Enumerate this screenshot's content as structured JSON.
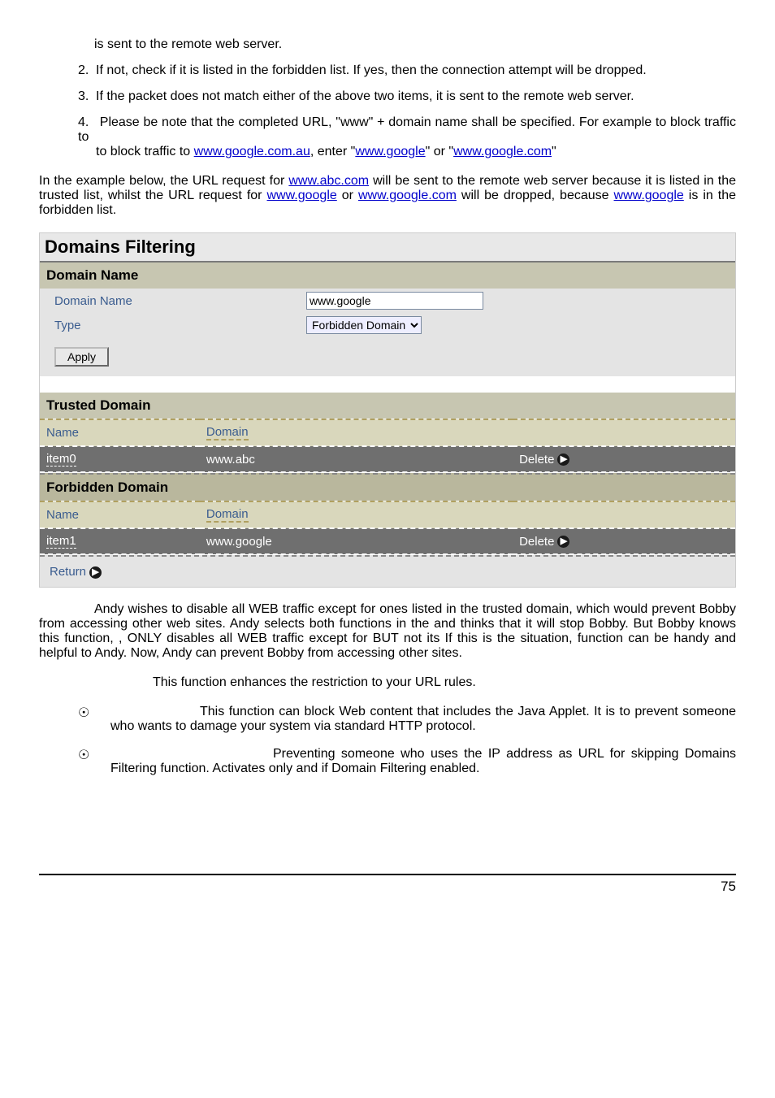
{
  "intro_line": "is sent to the remote web server.",
  "list": {
    "i2": "If not, check if it is listed in the forbidden list.  If yes, then the connection attempt will be dropped.",
    "i3": "If the packet does not match either of the above two items, it is sent to the remote web server.",
    "i4a": "Please be note that the completed URL, \"www\" + domain name shall be specified. For example to block traffic to ",
    "i4_link1": "www.google.com.au",
    "i4b": ", enter \"",
    "i4_link2": "www.google",
    "i4c": "\" or \"",
    "i4_link3": "www.google.com",
    "i4d": "\""
  },
  "example": {
    "a": "In the example below, the URL request for ",
    "l1": "www.abc.com",
    "b": " will be sent to the remote web server because it is listed in the trusted list, whilst the URL request for ",
    "l2": "www.google",
    "c": " or ",
    "l3": "www.google.com",
    "d": " will be dropped, because ",
    "l4": "www.google",
    "e": " is in the forbidden list."
  },
  "shot": {
    "title": "Domains Filtering",
    "domain_name_header": "Domain Name",
    "row_domain_label": "Domain Name",
    "row_domain_value": "www.google",
    "row_type_label": "Type",
    "row_type_value": "Forbidden Domain",
    "apply": "Apply",
    "trusted_header": "Trusted Domain",
    "col_name": "Name",
    "col_domain": "Domain",
    "trusted_row_name": "item0",
    "trusted_row_domain": "www.abc",
    "delete": "Delete",
    "forbidden_header": "Forbidden Domain",
    "forbidden_row_name": "item1",
    "forbidden_row_domain": "www.google",
    "return": "Return"
  },
  "andy": {
    "p1a": "Andy wishes to disable all WEB traffic except for ones listed in the trusted domain, which would prevent Bobby from accessing other web sites.  Andy selects both functions in the ",
    "p1b": " and thinks that it will stop Bobby.  But Bobby knows this function, ",
    "p1c": ", ONLY disables all WEB traffic except for ",
    "p1d": " BUT not its ",
    "p1e": " If this is the situation, ",
    "p1f": " function can be handy and helpful to Andy.  Now, Andy can prevent Bobby from accessing other sites.",
    "p2": "This function enhances the restriction to your URL rules."
  },
  "bullets": {
    "b1": "This function can block Web content that includes the Java Applet. It is to prevent someone who wants to damage your system via standard HTTP protocol.",
    "b2": "Preventing someone who uses the IP address as URL for skipping Domains Filtering function.  Activates only and if Domain Filtering enabled."
  },
  "page_number": "75"
}
